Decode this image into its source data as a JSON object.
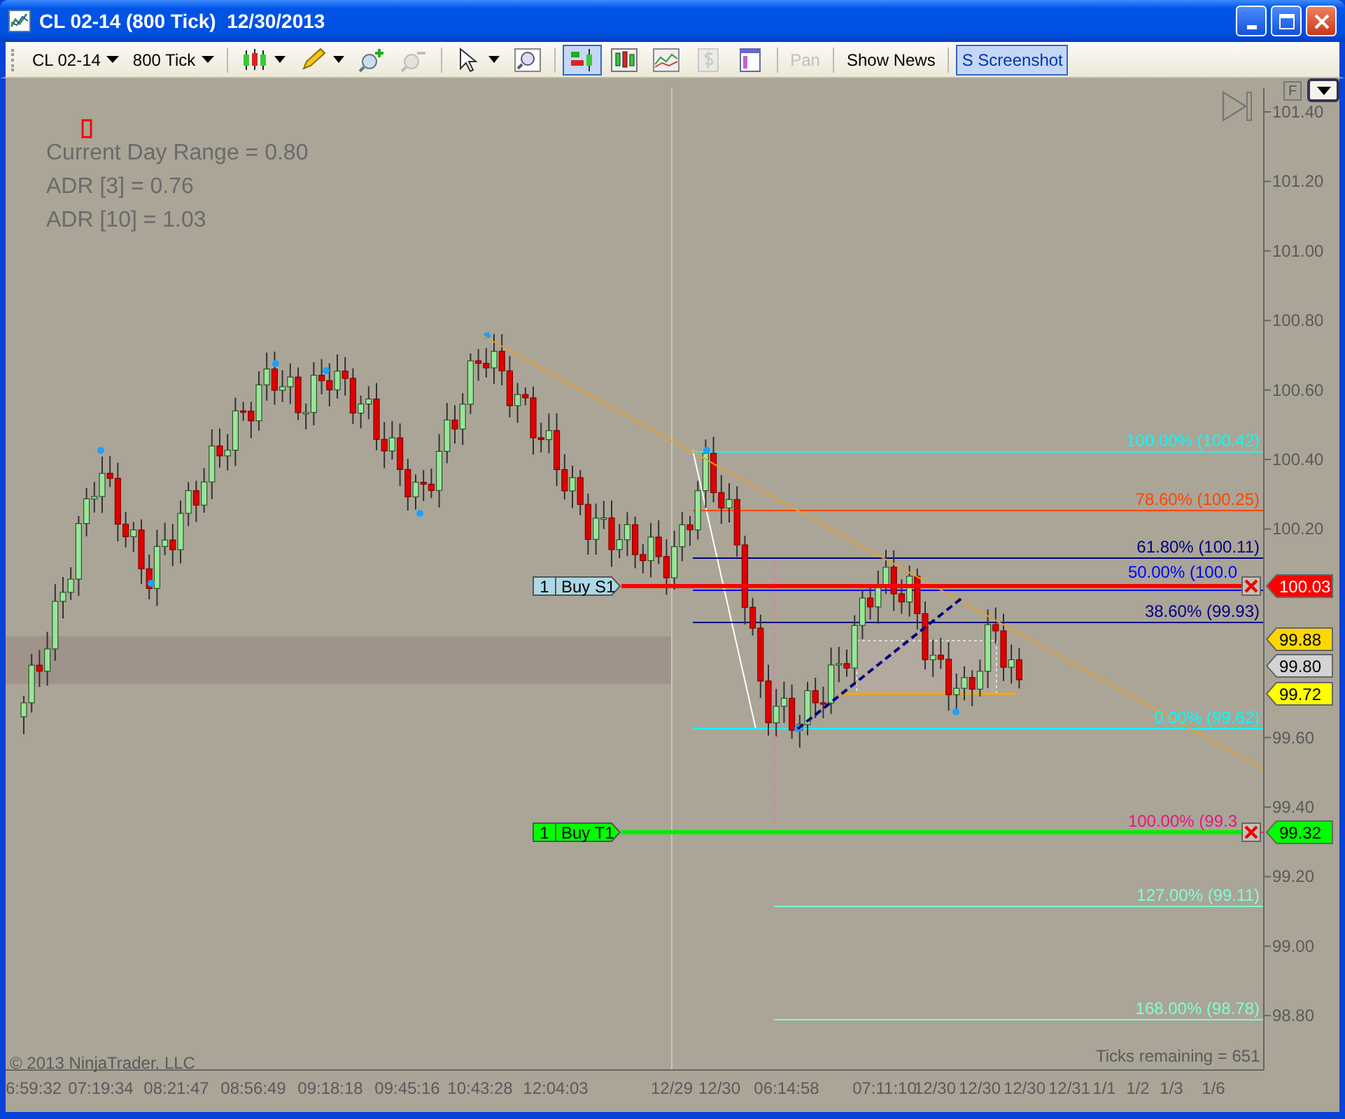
{
  "window": {
    "title": "CL 02-14 (800 Tick)  12/30/2013"
  },
  "toolbar_groups": [
    [
      {
        "kind": "dropdown",
        "label": "CL 02-14",
        "disabled": false,
        "selected": false
      },
      {
        "kind": "dropdown",
        "label": "800 Tick",
        "disabled": false,
        "selected": false
      }
    ],
    [
      {
        "kind": "bars",
        "disabled": false,
        "selected": false
      },
      {
        "kind": "pencil",
        "disabled": false,
        "selected": false
      },
      {
        "kind": "zoomin",
        "disabled": false,
        "selected": false
      },
      {
        "kind": "zoomout",
        "disabled": true,
        "selected": false
      }
    ],
    [
      {
        "kind": "pointer",
        "disabled": false,
        "selected": false
      },
      {
        "kind": "magnifier",
        "disabled": false,
        "selected": false
      }
    ],
    [
      {
        "kind": "strategy",
        "disabled": false,
        "selected": true
      },
      {
        "kind": "candles",
        "disabled": false,
        "selected": false
      },
      {
        "kind": "indicator",
        "disabled": false,
        "selected": false
      },
      {
        "kind": "dollar",
        "disabled": true,
        "selected": false
      },
      {
        "kind": "panel",
        "disabled": false,
        "selected": false
      }
    ],
    [
      {
        "kind": "text",
        "label": "Pan",
        "disabled": true,
        "selected": false
      }
    ],
    [
      {
        "kind": "text",
        "label": "Show News",
        "disabled": false,
        "selected": false
      }
    ],
    [
      {
        "kind": "text",
        "label": "S Screenshot",
        "disabled": false,
        "selected": true
      }
    ]
  ],
  "chart": {
    "scale_button": "F",
    "info_lines": [
      "Current Day Range = 0.80",
      "ADR [3] = 0.76",
      "ADR [10] = 1.03"
    ],
    "price_labels": [
      "101.40",
      "101.20",
      "101.00",
      "100.80",
      "100.60",
      "100.40",
      "100.20",
      "99.60",
      "99.40",
      "99.20",
      "99.00",
      "98.80"
    ],
    "time_labels": [
      "6:59:32",
      "07:19:34",
      "08:21:47",
      "08:56:49",
      "09:18:18",
      "09:45:16",
      "10:43:28",
      "12:04:03",
      "12/29",
      "12/30",
      "06:14:58",
      "07:11:10",
      "12/30",
      "12/30",
      "12/30",
      "12/31",
      "1/1",
      "1/2",
      "1/3",
      "1/6"
    ],
    "fib_levels": [
      {
        "label": "100.00% (100.42)",
        "color": "#00ffff"
      },
      {
        "label": "78.60% (100.25)",
        "color": "#ff4500"
      },
      {
        "label": "61.80% (100.11)",
        "color": "#000080"
      },
      {
        "label": "50.00% (100.0",
        "color": "#0000ff"
      },
      {
        "label": "38.60% (99.93)",
        "color": "#000080"
      },
      {
        "label": "0.00% (99.62)",
        "color": "#00ffff"
      },
      {
        "label": "100.00% (99.3",
        "color": "#e6177f"
      },
      {
        "label": "127.00% (99.11)",
        "color": "#7fffd4"
      },
      {
        "label": "168.00% (98.78)",
        "color": "#7fffd4"
      }
    ],
    "orders": [
      {
        "quantity": "1",
        "label": "Buy S1",
        "color": "#add8e6"
      },
      {
        "quantity": "1",
        "label": "Buy T1",
        "color": "#00ff00"
      }
    ],
    "price_flags": [
      {
        "text": "100.03",
        "color": "#ff0000"
      },
      {
        "text": "99.88",
        "color": "#ffd700"
      },
      {
        "text": "99.80",
        "color": "#d3d3d3"
      },
      {
        "text": "99.72",
        "color": "#ffff00"
      },
      {
        "text": "99.32",
        "color": "#00ff00"
      }
    ],
    "ticks_remaining": "Ticks remaining = 651",
    "copyright": "© 2013 NinjaTrader, LLC"
  }
}
